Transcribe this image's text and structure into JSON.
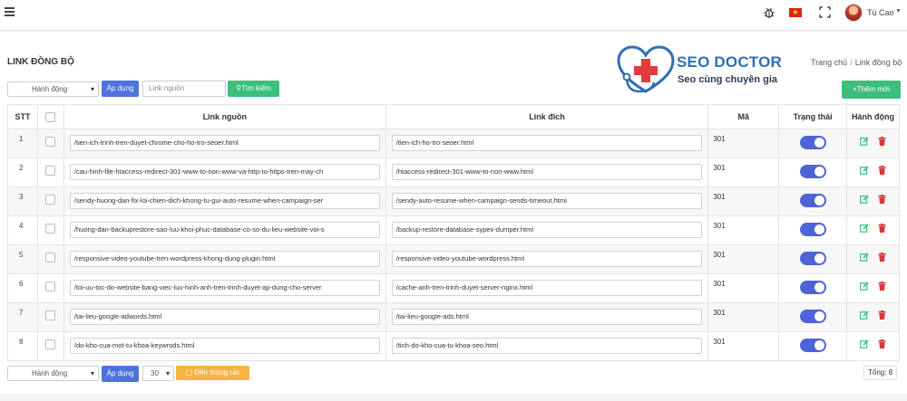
{
  "header": {
    "user_name": "Tú Cao",
    "icons": [
      "menu-icon",
      "bug-icon",
      "vietnam-flag-icon",
      "fullscreen-icon",
      "avatar",
      "chevron-down-icon"
    ]
  },
  "page": {
    "title": "LINK ĐỒNG BỘ",
    "breadcrumb": [
      "Trang chủ",
      "Link đồng bộ"
    ]
  },
  "logo": {
    "name": "SEO DOCTOR",
    "tagline": "Seo cùng chuyên gia"
  },
  "toolbar_top": {
    "action_select": "Hành động",
    "apply_label": "Áp dụng",
    "search_placeholder": "Link nguồn",
    "search_label": "Tìm kiếm",
    "add_label": "Thêm mới"
  },
  "table": {
    "headers": [
      "STT",
      "",
      "Link nguồn",
      "Link đích",
      "Mã",
      "Trạng thái",
      "Hành động"
    ],
    "rows": [
      {
        "stt": "1",
        "src": "/tien-ich-trinh-tren-duyet-chrome-cho-ho-tro-seoer.html",
        "dst": "/tien-ich-ho-tro-seoer.html",
        "code": "301",
        "active": true
      },
      {
        "stt": "2",
        "src": "/cau-hinh-file-htaccess-redirect-301-www-to-non-www-va-http-to-https-tren-may-ch",
        "dst": "/htaccess-redirect-301-www-to-non-www.html",
        "code": "301",
        "active": true
      },
      {
        "stt": "3",
        "src": "/sendy-huong-dan-fix-loi-chien-dich-khong-tu-gui-auto-resume-when-campaign-ser",
        "dst": "/sendy-auto-resume-when-campaign-sends-timeout.html",
        "code": "301",
        "active": true
      },
      {
        "stt": "4",
        "src": "/huong-dan-backuprestore-sao-luu-khoi-phuc-database-co-so-du-lieu-website-voi-s",
        "dst": "/backup-restore-database-sypex-dumper.html",
        "code": "301",
        "active": true
      },
      {
        "stt": "5",
        "src": "/responsive-video-youtube-tren-wordpress-khong-dung-plugin.html",
        "dst": "/responsive-video-youtube-wordpress.html",
        "code": "301",
        "active": true
      },
      {
        "stt": "6",
        "src": "/toi-uu-toc-do-website-bang-viec-luu-hinh-anh-tren-trinh-duyet-ap-dung-cho-server",
        "dst": "/cache-anh-tren-trinh-duyet-server-nginx.html",
        "code": "301",
        "active": true
      },
      {
        "stt": "7",
        "src": "/tai-lieu-google-adwords.html",
        "dst": "/tai-lieu-google-ads.html",
        "code": "301",
        "active": true
      },
      {
        "stt": "8",
        "src": "/do-kho-cua-mot-tu-khoa-keywrods.html",
        "dst": "/tinh-do-kho-cua-tu-khoa-seo.html",
        "code": "301",
        "active": true
      }
    ]
  },
  "toolbar_bottom": {
    "action_select": "Hành động",
    "apply_label": "Áp dụng",
    "per_page": "30",
    "trash_label": "Đến thùng rác",
    "total_label": "Tổng: 8"
  },
  "colors": {
    "primary": "#4e73df",
    "success": "#3cbf7c",
    "warning": "#f4b342",
    "toggle": "#4e63d8",
    "edit": "#3cbf7c",
    "delete": "#d9383a"
  }
}
